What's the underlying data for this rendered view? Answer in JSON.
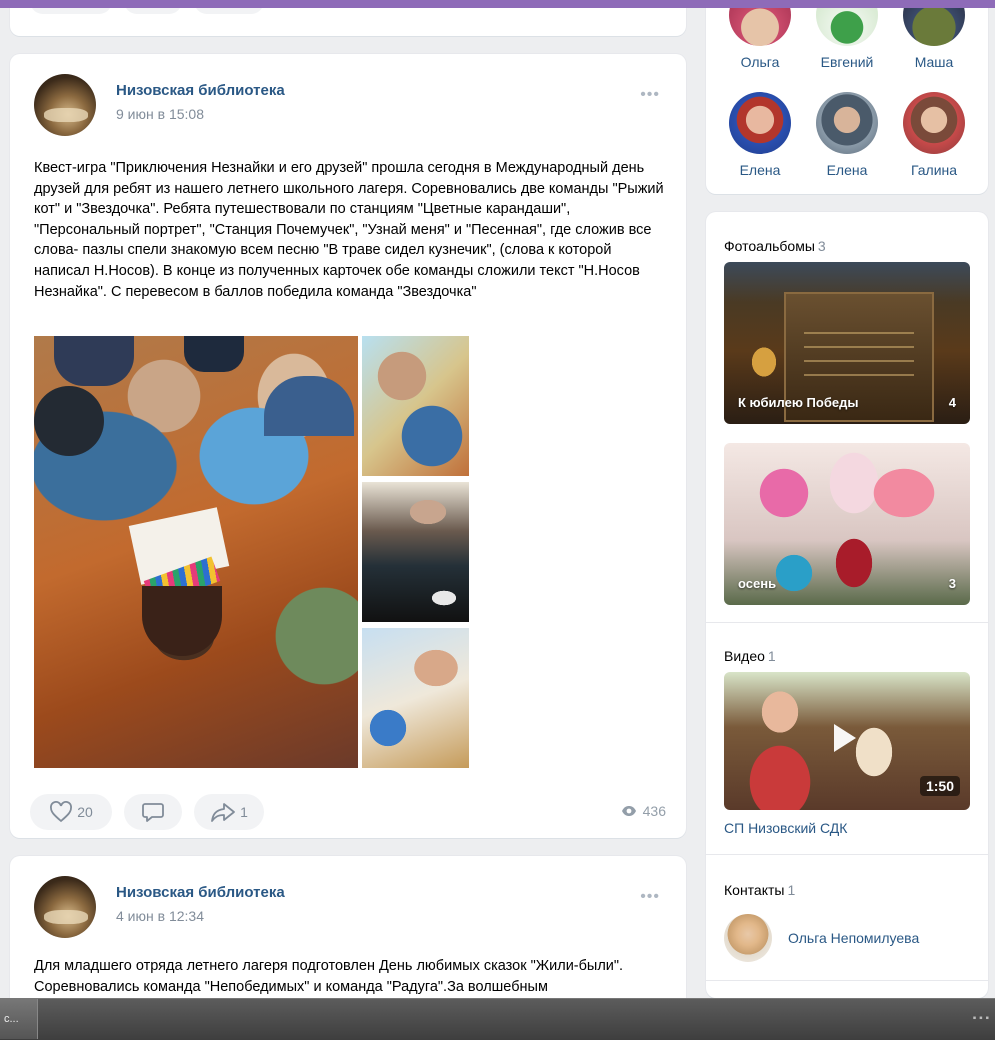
{
  "feed": {
    "post1": {
      "author": "Низовская библиотека",
      "date": "9 июн в 15:08",
      "text": "Квест-игра \"Приключения Незнайки и его друзей\" прошла сегодня в Международный день друзей для ребят из нашего летнего школьного лагеря. Соревновались две команды \"Рыжий кот\" и \"Звездочка\". Ребята путешествовали по станциям \"Цветные карандаши\", \"Персональный портрет\", \"Станция Почемучек\", \"Узнай меня\" и \"Песенная\", где сложив все слова- пазлы спели знакомую всем песню \"В траве сидел кузнечик\", (слова к которой написал Н.Носов). В конце из полученных карточек обе команды сложили текст \"Н.Носов Незнайка\". С перевесом в баллов победила команда \"Звездочка\"",
      "likes": "20",
      "shares": "1",
      "views": "436"
    },
    "post2": {
      "author": "Низовская библиотека",
      "date": "4 июн в 12:34",
      "text": "Для младшего отряда летнего лагеря подготовлен День любимых сказок \"Жили-были\". Соревновались команда \"Непобедимых\" и команда \"Радуга\".За волшебным"
    }
  },
  "sidebar": {
    "friends_row1": [
      "Ольга",
      "Евгений",
      "Маша"
    ],
    "friends_row2": [
      "Елена",
      "Елена",
      "Галина"
    ],
    "albums": {
      "title": "Фотоальбомы",
      "count": "3",
      "items": [
        {
          "name": "К юбилею Победы",
          "count": "4"
        },
        {
          "name": "осень",
          "count": "3"
        }
      ]
    },
    "videos": {
      "title": "Видео",
      "count": "1",
      "duration": "1:50",
      "video_title": "СП Низовский СДК"
    },
    "contacts": {
      "title": "Контакты",
      "count": "1",
      "name": "Ольга Непомилуева"
    }
  },
  "taskbar": {
    "item_label": "с..."
  },
  "colors": {
    "link": "#2a5885",
    "muted": "#818c99",
    "frame": "#8e6bb8",
    "background": "#edeef0"
  }
}
